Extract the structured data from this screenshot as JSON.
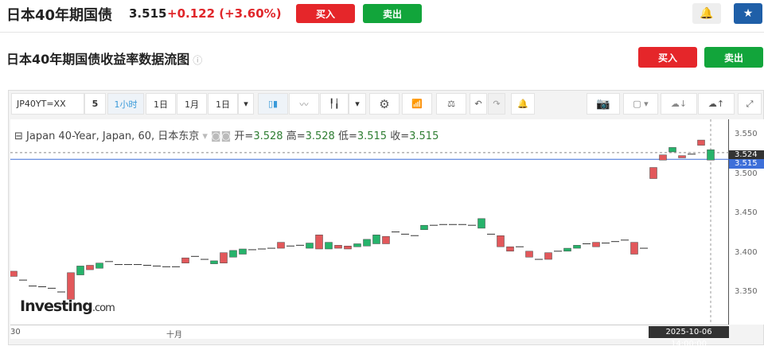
{
  "header": {
    "title": "日本40年期国债",
    "price": "3.515",
    "change": "+0.122 (+3.60%)",
    "buy": "买入",
    "sell": "卖出",
    "alert_icon": "bell-plus-icon",
    "star_icon": "star-icon"
  },
  "sub": {
    "title": "日本40年期国债收益率数据流图",
    "info_icon": "ⓘ",
    "buy": "买入",
    "sell": "卖出"
  },
  "toolbar": {
    "symbol": "JP40YT=XX",
    "interval_num": "5",
    "interval_active": "1小时",
    "i1": "1日",
    "i2": "1月",
    "i3": "1日"
  },
  "legend": {
    "name": "Japan 40-Year, Japan, 60, 日本东京",
    "open_label": "开=",
    "open": "3.528",
    "high_label": "高=",
    "high": "3.528",
    "low_label": "低=",
    "low": "3.515",
    "close_label": "收=",
    "close": "3.515"
  },
  "chart_data": {
    "type": "candlestick",
    "ylim": [
      3.292,
      3.569
    ],
    "yticks": [
      "3.550",
      "3.500",
      "3.450",
      "3.400",
      "3.350"
    ],
    "xticks": [
      "30",
      "十月"
    ],
    "last_price": "3.524",
    "current_price": "3.515",
    "crosshair_time": "2025-10-06 14:00:00",
    "colors": {
      "up": "#26b36b",
      "down": "#e2585b"
    },
    "candles": [
      [
        3.364,
        3.357
      ],
      [
        3.352,
        3.352
      ],
      [
        3.344,
        3.344
      ],
      [
        3.343,
        3.343
      ],
      [
        3.341,
        3.341
      ],
      [
        3.336,
        3.336
      ],
      [
        3.362,
        3.326
      ],
      [
        3.359,
        3.371
      ],
      [
        3.372,
        3.366
      ],
      [
        3.368,
        3.375
      ],
      [
        3.377,
        3.377
      ],
      [
        3.373,
        3.373
      ],
      [
        3.373,
        3.373
      ],
      [
        3.373,
        3.373
      ],
      [
        3.372,
        3.372
      ],
      [
        3.371,
        3.371
      ],
      [
        3.37,
        3.37
      ],
      [
        3.37,
        3.37
      ],
      [
        3.382,
        3.375
      ],
      [
        3.384,
        3.384
      ],
      [
        3.38,
        3.38
      ],
      [
        3.374,
        3.378
      ],
      [
        3.389,
        3.375
      ],
      [
        3.383,
        3.392
      ],
      [
        3.387,
        3.394
      ],
      [
        3.393,
        3.393
      ],
      [
        3.394,
        3.394
      ],
      [
        3.395,
        3.395
      ],
      [
        3.403,
        3.395
      ],
      [
        3.398,
        3.398
      ],
      [
        3.399,
        3.399
      ],
      [
        3.395,
        3.402
      ],
      [
        3.413,
        3.394
      ],
      [
        3.394,
        3.403
      ],
      [
        3.399,
        3.395
      ],
      [
        3.398,
        3.394
      ],
      [
        3.397,
        3.401
      ],
      [
        3.398,
        3.407
      ],
      [
        3.401,
        3.413
      ],
      [
        3.411,
        3.401
      ],
      [
        3.417,
        3.417
      ],
      [
        3.414,
        3.414
      ],
      [
        3.412,
        3.412
      ],
      [
        3.42,
        3.426
      ],
      [
        3.426,
        3.426
      ],
      [
        3.427,
        3.427
      ],
      [
        3.427,
        3.427
      ],
      [
        3.427,
        3.427
      ],
      [
        3.426,
        3.426
      ],
      [
        3.422,
        3.435
      ],
      [
        3.414,
        3.414
      ],
      [
        3.412,
        3.397
      ],
      [
        3.397,
        3.391
      ],
      [
        3.397,
        3.397
      ],
      [
        3.391,
        3.383
      ],
      [
        3.38,
        3.38
      ],
      [
        3.389,
        3.38
      ],
      [
        3.391,
        3.391
      ],
      [
        3.391,
        3.395
      ],
      [
        3.395,
        3.399
      ],
      [
        3.401,
        3.401
      ],
      [
        3.403,
        3.397
      ],
      [
        3.402,
        3.402
      ],
      [
        3.404,
        3.404
      ],
      [
        3.406,
        3.406
      ],
      [
        3.403,
        3.387
      ],
      [
        3.395,
        3.395
      ],
      [
        3.504,
        3.489
      ],
      [
        3.521,
        3.514
      ],
      [
        3.525,
        3.531
      ],
      [
        3.52,
        3.517
      ],
      [
        3.522,
        3.522
      ],
      [
        3.541,
        3.534
      ],
      [
        3.514,
        3.528
      ]
    ]
  }
}
